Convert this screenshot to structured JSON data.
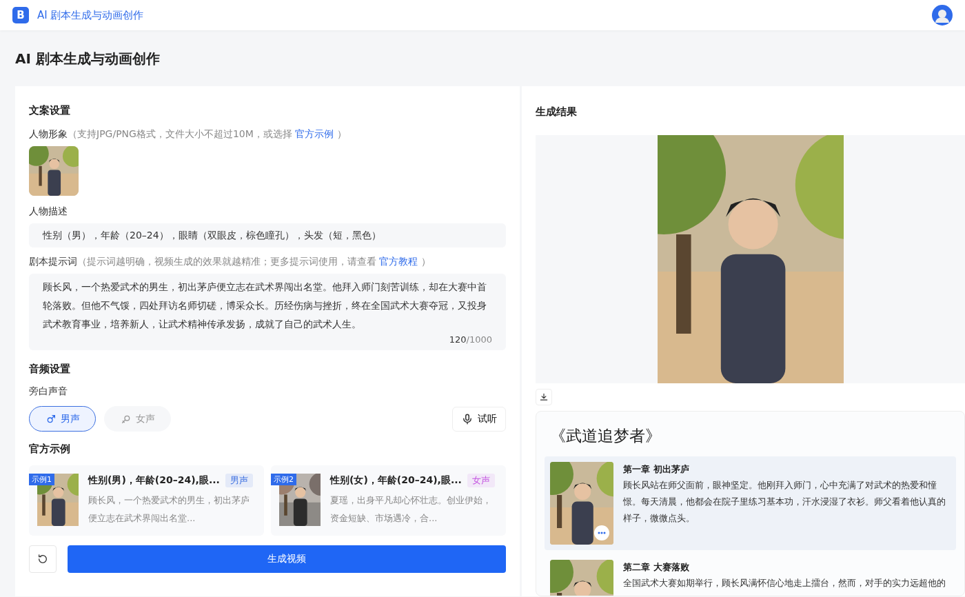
{
  "header": {
    "logo": "B",
    "title": "AI 剧本生成与动画创作"
  },
  "page_title": "AI 剧本生成与动画创作",
  "settings": {
    "title": "文案设置",
    "image_field": {
      "label": "人物形象",
      "hint": "（支持JPG/PNG格式，文件大小不超过10M，或选择",
      "link": "官方示例",
      "hint_end": "）"
    },
    "description": {
      "label": "人物描述",
      "value": "性别（男），年龄（20–24），眼睛（双眼皮，棕色瞳孔），头发（短，黑色）"
    },
    "prompt": {
      "label": "剧本提示词",
      "hint": "（提示词越明确，视频生成的效果就越精准；更多提示词使用，请查看",
      "link": "官方教程",
      "hint_end": "）",
      "value": "顾长风，一个热爱武术的男生，初出茅庐便立志在武术界闯出名堂。他拜入师门刻苦训练，却在大赛中首轮落败。但他不气馁，四处拜访名师切磋，博采众长。历经伤病与挫折，终在全国武术大赛夺冠，又投身武术教育事业，培养新人，让武术精神传承发扬，成就了自己的武术人生。",
      "count": "120",
      "limit": "/1000"
    }
  },
  "audio": {
    "title": "音频设置",
    "voice_label": "旁白声音",
    "voices": [
      {
        "label": "男声",
        "kind": "male",
        "selected": true
      },
      {
        "label": "女声",
        "kind": "female",
        "selected": false
      }
    ],
    "listen_button": "试听"
  },
  "examples": {
    "title": "官方示例",
    "items": [
      {
        "badge": "示例1",
        "title": "性别(男)，年龄(20–24),眼...",
        "tag": "男声",
        "color": "#3b6fe0",
        "kind": "male",
        "text": "顾长风，一个热爱武术的男生，初出茅庐便立志在武术界闯出名堂..."
      },
      {
        "badge": "示例2",
        "title": "性别(女)，年龄(20–24),眼...",
        "tag": "女声",
        "color": "#c455e0",
        "kind": "female",
        "text": "夏瑶，出身平凡却心怀壮志。创业伊始，资金短缺、市场遇冷，合..."
      }
    ]
  },
  "generate_button": "生成视频",
  "result": {
    "title": "生成结果",
    "story_title": "《武道追梦者》",
    "chapters": [
      {
        "title": "第一章 初出茅庐",
        "selected": true,
        "text": "顾长风站在师父面前，眼神坚定。他刚拜入师门，心中充满了对武术的热爱和憧憬。每天清晨，他都会在院子里练习基本功，汗水浸湿了衣衫。师父看着他认真的样子，微微点头。"
      },
      {
        "title": "第二章 大赛落败",
        "selected": false,
        "text": "全国武术大赛如期举行，顾长风满怀信心地走上擂台，然而，对手的实力远超他的"
      }
    ]
  }
}
